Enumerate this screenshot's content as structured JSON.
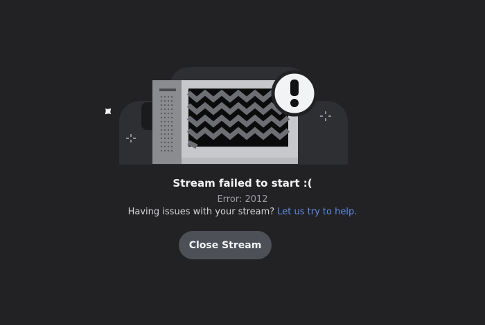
{
  "illustration": {
    "icon": "broken-stream-tv-icon",
    "badge_icon": "exclamation-icon"
  },
  "dialog": {
    "title": "Stream failed to start :(",
    "error_code": "Error: 2012",
    "help_text": "Having issues with your stream?",
    "help_link": "Let us try to help.",
    "close_button": "Close Stream"
  },
  "colors": {
    "background": "#222224",
    "button": "#4e5058",
    "link": "#5b8de8",
    "title": "#f2f3f5",
    "muted": "#9a9ca3"
  }
}
